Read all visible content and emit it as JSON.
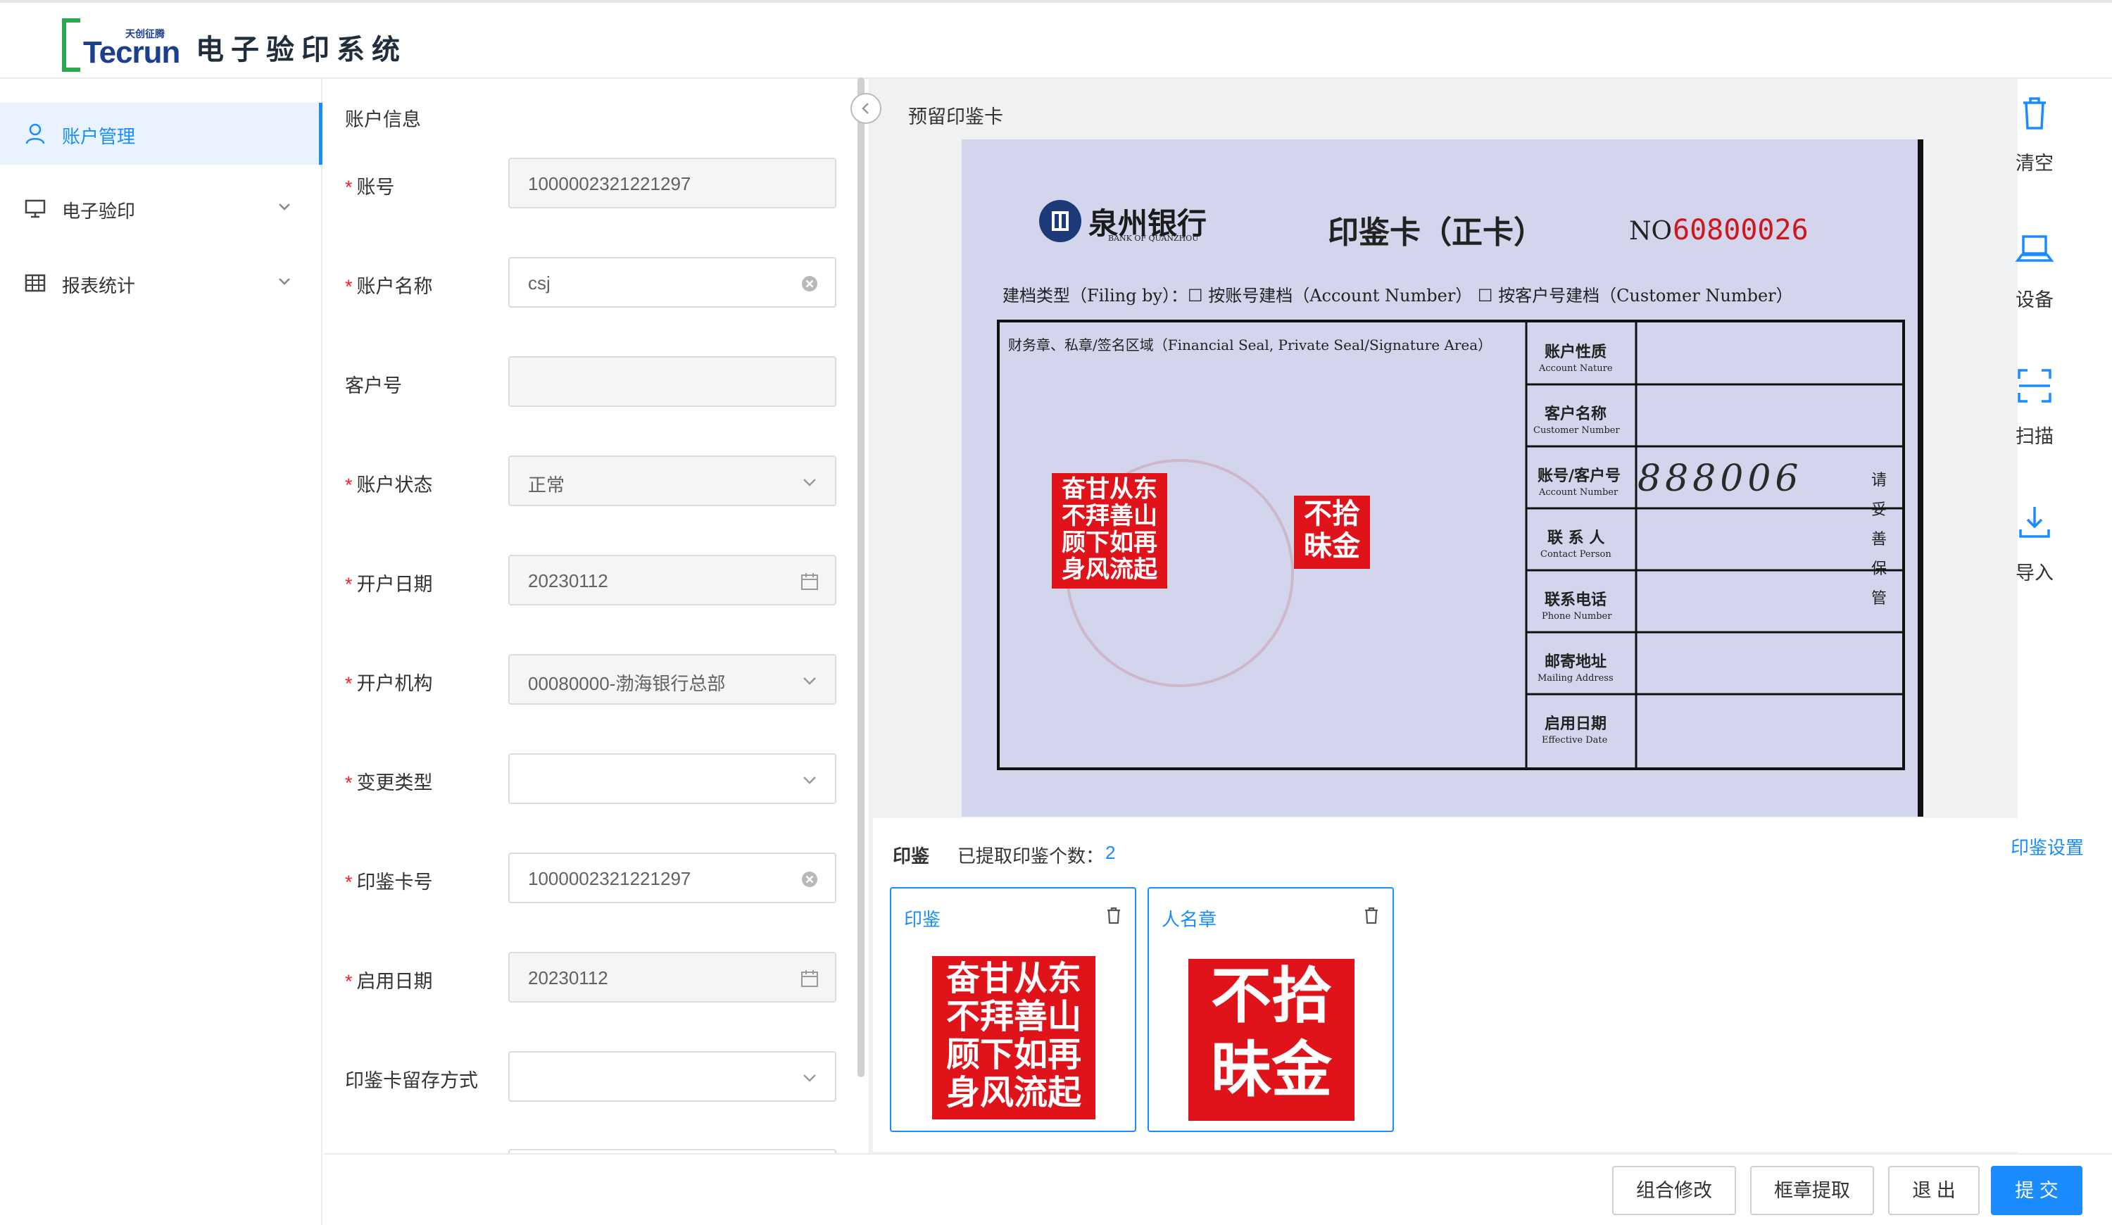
{
  "header": {
    "logo_text_en": "Tecrun",
    "logo_text_cn": "天创征腾",
    "title": "电子验印系统"
  },
  "sidebar": {
    "items": [
      {
        "label": "账户管理",
        "icon": "user-icon",
        "active": true
      },
      {
        "label": "电子验印",
        "icon": "monitor-icon",
        "expandable": true
      },
      {
        "label": "报表统计",
        "icon": "table-icon",
        "expandable": true
      }
    ]
  },
  "form": {
    "section_title": "账户信息",
    "fields": [
      {
        "label": "账号",
        "required": true,
        "value": "1000002321221297"
      },
      {
        "label": "账户名称",
        "required": true,
        "value": "csj",
        "clearable": true
      },
      {
        "label": "客户号",
        "required": false,
        "value": ""
      },
      {
        "label": "账户状态",
        "required": true,
        "value": "正常",
        "type": "select"
      },
      {
        "label": "开户日期",
        "required": true,
        "value": "20230112",
        "type": "date"
      },
      {
        "label": "开户机构",
        "required": true,
        "value": "00080000-渤海银行总部",
        "type": "select"
      },
      {
        "label": "变更类型",
        "required": true,
        "value": "",
        "type": "select"
      },
      {
        "label": "印鉴卡号",
        "required": true,
        "value": "1000002321221297",
        "clearable": true
      },
      {
        "label": "启用日期",
        "required": true,
        "value": "20230112",
        "type": "date"
      },
      {
        "label": "印鉴卡留存方式",
        "required": false,
        "value": "",
        "type": "select"
      }
    ]
  },
  "card": {
    "title": "预留印鉴卡",
    "bank_name": "泉州银行",
    "bank_name_en": "BANK OF QUANZHOU",
    "card_heading": "印鉴卡（正卡）",
    "card_no_prefix": "NO",
    "card_no": "60800026",
    "filing_line": "建档类型（Filing by）：☐ 按账号建档（Account Number）   ☐ 按客户号建档（Customer Number）",
    "seal_area_label": "财务章、私章/签名区域（Financial Seal, Private Seal/Signature Area）",
    "side_note": "请妥善保管",
    "rows": [
      {
        "cn": "账户性质",
        "en": "Account  Nature",
        "value": ""
      },
      {
        "cn": "客户名称",
        "en": "Customer  Number",
        "value": ""
      },
      {
        "cn": "账号/客户号",
        "en": "Account Number",
        "value": "888006"
      },
      {
        "cn": "联 系 人",
        "en": "Contact  Person",
        "value": ""
      },
      {
        "cn": "联系电话",
        "en": "Phone  Number",
        "value": ""
      },
      {
        "cn": "邮寄地址",
        "en": "Mailing  Address",
        "value": ""
      },
      {
        "cn": "启用日期",
        "en": "Effective  Date",
        "value": ""
      }
    ],
    "stamp_large_lines": [
      "奋甘从东",
      "不拜善山",
      "顾下如再",
      "身风流起"
    ],
    "stamp_small_lines": [
      "不拾",
      "昧金"
    ]
  },
  "tools": [
    {
      "label": "清空",
      "icon": "trash-icon"
    },
    {
      "label": "设备",
      "icon": "laptop-icon"
    },
    {
      "label": "扫描",
      "icon": "scan-icon"
    },
    {
      "label": "导入",
      "icon": "import-icon"
    }
  ],
  "seals": {
    "heading": "印鉴",
    "count_label": "已提取印鉴个数：",
    "count": "2",
    "settings_label": "印鉴设置",
    "items": [
      {
        "title": "印鉴",
        "lines": [
          "奋甘从东",
          "不拜善山",
          "顾下如再",
          "身风流起"
        ]
      },
      {
        "title": "人名章",
        "lines": [
          "不拾",
          "昧金"
        ]
      }
    ]
  },
  "footer": {
    "buttons": [
      {
        "label": "组合修改"
      },
      {
        "label": "框章提取"
      },
      {
        "label": "退 出"
      },
      {
        "label": "提 交",
        "primary": true
      }
    ]
  },
  "colors": {
    "accent": "#1a8cff",
    "required": "#f5222d",
    "stamp_red": "#e0131b"
  }
}
